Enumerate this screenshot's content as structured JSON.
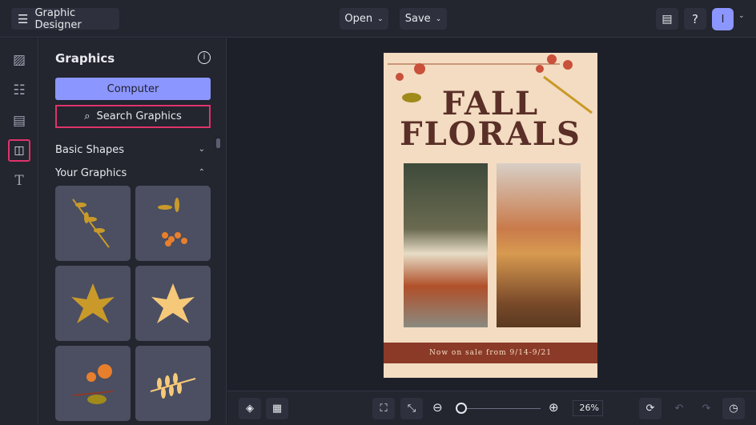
{
  "app": {
    "title": "Graphic Designer",
    "open": "Open",
    "save": "Save",
    "avatar": "I"
  },
  "panel": {
    "heading": "Graphics",
    "computer": "Computer",
    "search": "Search Graphics",
    "basic_shapes": "Basic Shapes",
    "your_graphics": "Your Graphics"
  },
  "poster": {
    "line1": "FALL",
    "line2": "FLORALS",
    "banner": "Now on sale from 9/14-9/21"
  },
  "zoom": {
    "value": "26%",
    "level": 26
  },
  "colors": {
    "accent": "#8c96ff",
    "highlight": "#e0336b",
    "banner": "#8b3a28"
  }
}
